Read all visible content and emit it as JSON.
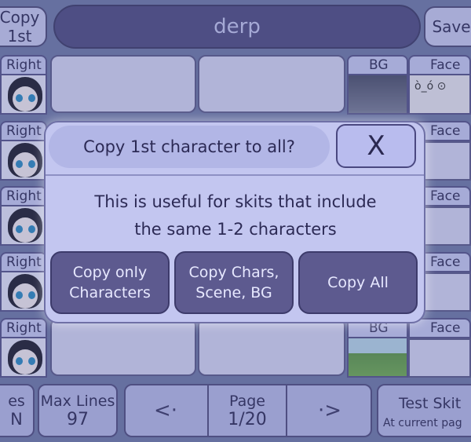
{
  "header": {
    "copy_first_label": "Copy 1st",
    "title": "derp",
    "save_label": "Save"
  },
  "rows": [
    {
      "label": "Right"
    },
    {
      "label": "Right"
    },
    {
      "label": "Right"
    },
    {
      "label": "Right"
    },
    {
      "label": "Right"
    }
  ],
  "side_columns": {
    "bg_label": "BG",
    "face_label": "Face"
  },
  "modal": {
    "title": "Copy 1st character to all?",
    "close_glyph": "X",
    "message_line1": "This is useful for skits that include",
    "message_line2": "the same 1-2 characters",
    "buttons": {
      "copy_only_line1": "Copy only",
      "copy_only_line2": "Characters",
      "copy_chars_line1": "Copy Chars,",
      "copy_chars_line2": "Scene, BG",
      "copy_all": "Copy All"
    }
  },
  "footer": {
    "lines_label": "es",
    "lines_value": "N",
    "max_lines_label": "Max Lines",
    "max_lines_value": "97",
    "prev_glyph": "<·",
    "page_label": "Page",
    "page_value": "1/20",
    "next_glyph": "·>",
    "test_skit_label": "Test Skit",
    "test_skit_sub": "At current pag"
  },
  "colors": {
    "background": "#707aa8",
    "header_pill": "#4e4c82",
    "button_dark": "#5d5a8f",
    "modal_panel": "#c3c6f0",
    "text_dark": "#2c2a55"
  }
}
